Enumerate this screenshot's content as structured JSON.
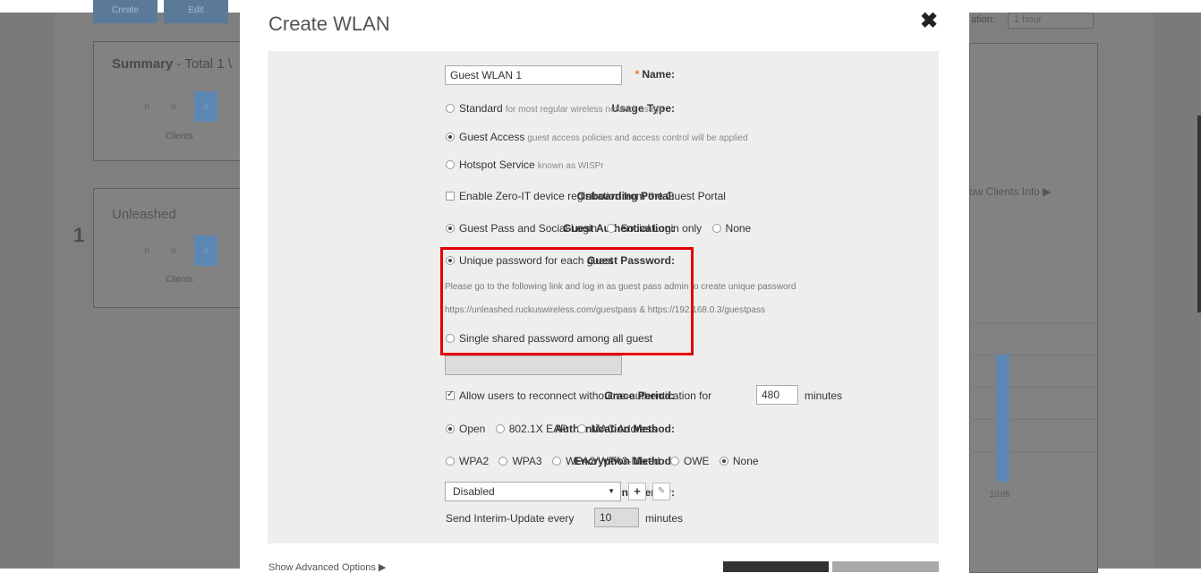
{
  "background": {
    "toolbar": {
      "create_label": "Create",
      "edit_label": "Edit",
      "duration_label": "ation:",
      "duration_value": "1 hour"
    },
    "summary_card": {
      "title_bold": "Summary",
      "title_rest": " - Total 1 \\",
      "cells": [
        "0",
        "0",
        "4"
      ],
      "caption": "Clients"
    },
    "unleashed_card": {
      "title": "Unleashed",
      "index": "1",
      "cells": [
        "0",
        "0",
        "4"
      ],
      "caption": "Clients"
    },
    "right_panel": {
      "link_text": "ow Clients Info ▶",
      "axis_tick": "10:05"
    }
  },
  "modal": {
    "title": "Create WLAN",
    "close_icon": "close-icon",
    "name": {
      "label": "Name:",
      "value": "Guest WLAN 1"
    },
    "usage_type": {
      "label": "Usage Type:",
      "options": [
        {
          "label": "Standard",
          "hint": "for most regular wireless network usage",
          "selected": false
        },
        {
          "label": "Guest Access",
          "hint": "guest access policies and access control will be applied",
          "selected": true
        },
        {
          "label": "Hotspot Service",
          "hint": "known as WISPr",
          "selected": false
        }
      ]
    },
    "onboarding_portal": {
      "label": "Onboarding Portal:",
      "checkbox_label": "Enable Zero-IT device registration from the Guest Portal",
      "checked": false
    },
    "guest_authentication": {
      "label": "Guest Authentication:",
      "options": [
        {
          "label": "Guest Pass and Social Login",
          "selected": true
        },
        {
          "label": "Social Login only",
          "selected": false
        },
        {
          "label": "None",
          "selected": false
        }
      ]
    },
    "guest_password": {
      "label": "Guest Password:",
      "option_unique": "Unique password for each guest",
      "note_line1": "Please go to the following link and log in as guest pass admin to create unique password",
      "note_line2": "https://unleashed.ruckuswireless.com/guestpass & https://192.168.0.3/guestpass",
      "option_shared": "Single shared password among all guest",
      "shared_value": ""
    },
    "grace_period": {
      "label": "Grace Period:",
      "checkbox_label": "Allow users to reconnect without re-authentication for",
      "value": "480",
      "unit": "minutes",
      "checked": true
    },
    "authentication_method": {
      "label": "Authentication Method:",
      "options": [
        {
          "label": "Open",
          "selected": true
        },
        {
          "label": "802.1X EAP",
          "selected": false
        },
        {
          "label": "MAC Address",
          "selected": false
        }
      ]
    },
    "encryption_method": {
      "label": "Encryption Method:",
      "options": [
        {
          "label": "WPA2",
          "selected": false
        },
        {
          "label": "WPA3",
          "selected": false
        },
        {
          "label": "WPA2/WPA3-Mixed",
          "selected": false
        },
        {
          "label": "OWE",
          "selected": false
        },
        {
          "label": "None",
          "selected": true
        }
      ]
    },
    "accounting_server": {
      "label": "Accounting Server:",
      "value": "Disabled",
      "add_label": "+",
      "interim_prefix": "Send Interim-Update every",
      "interim_value": "10",
      "interim_unit": "minutes"
    },
    "footer": {
      "advanced_label": "Show Advanced Options ▶"
    }
  },
  "colors": {
    "required": "#e87722",
    "highlight": "#e50000",
    "panel": "#eeeeee"
  }
}
